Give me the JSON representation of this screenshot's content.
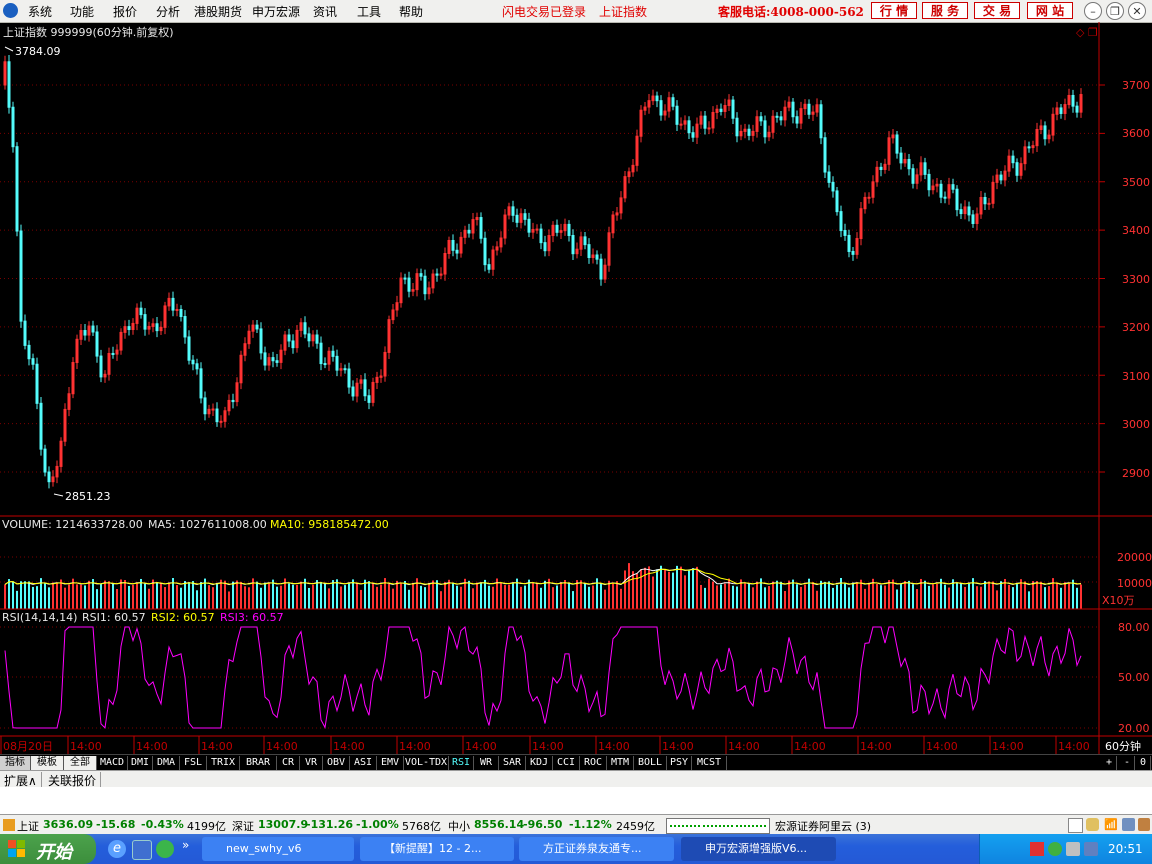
{
  "menu": {
    "items": [
      "系统",
      "功能",
      "报价",
      "分析",
      "港股期货",
      "申万宏源",
      "资讯",
      "工具",
      "帮助"
    ],
    "flash_status": "闪电交易已登录",
    "index_name": "上证指数",
    "hotline": "客服电话:4008-000-562",
    "buttons": [
      "行 情",
      "服 务",
      "交 易",
      "网 站"
    ]
  },
  "chart": {
    "title": "上证指数 999999(60分钟.前复权)",
    "high_label": "3784.09",
    "low_label": "2851.23",
    "price_ticks": [
      "3700",
      "3600",
      "3500",
      "3400",
      "3300",
      "3200",
      "3100",
      "3000",
      "2900"
    ],
    "volume_label": "VOLUME: 1214633728.00",
    "ma5_label": "MA5: 1027611008.00",
    "ma10_label": "MA10: 958185472.00",
    "volume_ticks": [
      "20000",
      "10000"
    ],
    "volume_unit": "X10万",
    "rsi_label": "RSI(14,14,14)",
    "rsi1": "RSI1: 60.57",
    "rsi2": "RSI2: 60.57",
    "rsi3": "RSI3: 60.57",
    "rsi_ticks": [
      "80.00",
      "50.00",
      "20.00"
    ],
    "time_first": "08月20日",
    "time_label": "14:00",
    "period": "60分钟",
    "colors": {
      "up": "#ff3232",
      "down": "#54fcfc",
      "ma5": "#ffffff",
      "ma10": "#ffff00",
      "rsi": "#ff00ff",
      "axis": "#c00000"
    }
  },
  "indicator_tabs": [
    "指标",
    "模板",
    "全部",
    "MACD",
    "DMI",
    "DMA",
    "FSL",
    "TRIX",
    "BRAR",
    "CR",
    "VR",
    "OBV",
    "ASI",
    "EMV",
    "VOL-TDX",
    "RSI",
    "WR",
    "SAR",
    "KDJ",
    "CCI",
    "ROC",
    "MTM",
    "BOLL",
    "PSY",
    "MCST"
  ],
  "indicator_active": "RSI",
  "scroll_controls": [
    "+",
    "-",
    "0"
  ],
  "sub_tabs": [
    "扩展∧",
    "关联报价"
  ],
  "status": {
    "sh_name": "上证",
    "sh_value": "3636.09",
    "sh_change": "-15.68",
    "sh_pct": "-0.43%",
    "sh_amount": "4199亿",
    "sz_name": "深证",
    "sz_value": "13007.9",
    "sz_change": "-131.26",
    "sz_pct": "-1.00%",
    "sz_amount": "5768亿",
    "zx_name": "中小",
    "zx_value": "8556.14",
    "zx_change": "-96.50",
    "zx_pct": "-1.12%",
    "zx_amount": "2459亿",
    "server": "宏源证券阿里云 (3)"
  },
  "taskbar": {
    "start": "开始",
    "tasks": [
      "new_swhy_v6",
      "【新提醒】12 - 2...",
      "方正证券泉友通专...",
      "申万宏源增强版V6..."
    ],
    "clock": "20:51"
  }
}
